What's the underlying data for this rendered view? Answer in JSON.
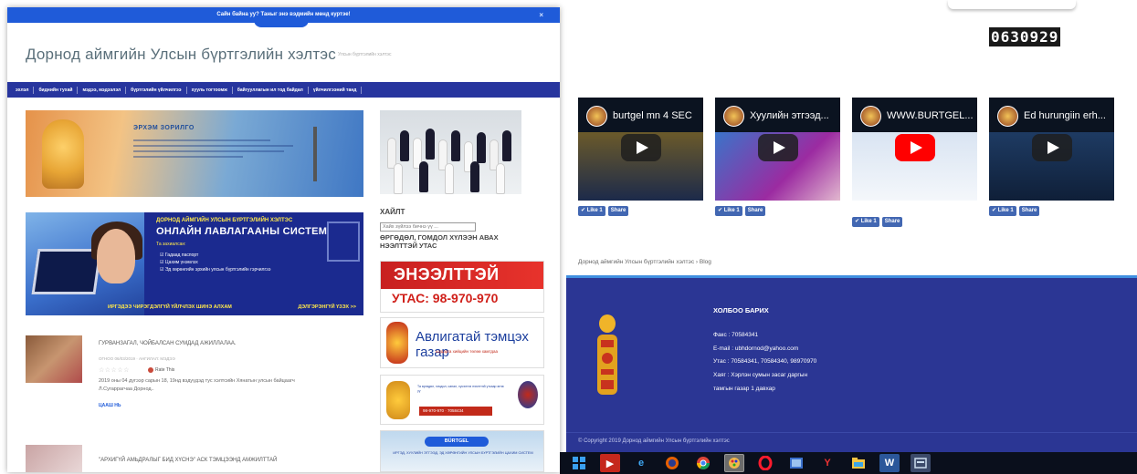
{
  "left_window": {
    "notice": "Сайн байна уу? Таныг энэ вэдмийн мөнд куртэе!",
    "notice_close": "×",
    "site_title": "Дорнод аймгийн Улсын бүртгэлийн хэлтэс",
    "site_tagline": "Улсын бүртгэлийн хэлтэс",
    "nav_items": [
      "эхлэл",
      "биднийн тухай",
      "мэдээ, мэдээлэл",
      "бүртгэлийн үйлчилгээ",
      "хууль тогтоомж",
      "байгууллагын ил тод байдал",
      "үйлчилгээний танд"
    ],
    "banner1": {
      "title": "ЭРХЭМ ЗОРИЛГО"
    },
    "banner2": {
      "subtitle": "ДОРНОД АЙМГИЙН УЛСЫН БҮРТГЭЛИЙН ХЭЛТЭС",
      "title": "ОНЛАЙН ЛАВЛАГААНЫ СИСТЕМ",
      "lead": "Та захиалсан:",
      "items": [
        "Гадаад паспорт",
        "Цахим үнэмлэх",
        "Эд хөрөнгийн эрхийн улсын бүртгэлийн гэрчилгээ"
      ],
      "footer_left": "ИРГЭДЭЭ ЧИРЭГДЭЛГҮЙ ҮЙЛЧЛЭХ ШИНЭ АЛХАМ",
      "footer_right": "ДЭЛГЭРЭНГҮЙ ҮЗЭХ >>"
    },
    "posts": [
      {
        "title": "ГУРВАНЗАГАЛ, ЧОЙБАЛСАН СУМДАД АЖИЛЛАЛАА.",
        "meta": "ОГНОО 06/03/2019 · АНГИЛАЛ: МЭДЭЭ",
        "stars": "☆☆☆☆☆",
        "rate": "Rate This",
        "excerpt": "2019 оны 04 дүгээр сарын 18, 19нд вэдүүдэд тус хэлтсийн Хянатын улсын байцаагч Л.Сугаррагчаа Дорнод..",
        "more": "ЦААШ НЬ"
      },
      {
        "title": "\"АРХИГҮЙ АМЬДРАЛЫГ БИД ХҮСНЭ\" АСК ТЭМЦЭЭНД АМЖИЛТТАЙ",
        "meta": "",
        "stars": "",
        "rate": "",
        "excerpt": "",
        "more": ""
      }
    ],
    "sidebar": {
      "search_heading": "ХАЙЛТ",
      "search_placeholder": "Хайх зүйлээ бичнэ үү ...",
      "complaint_heading": "ӨРГӨДӨЛ, ГОМДОЛ ХҮЛЭЭН АВАХ НЭЭЛТТЭЙ УТАС",
      "ad1_title": "ЭНЭЭЛТТЭЙ",
      "ad1_phone": "УТАС: 98-970-970",
      "ad2_title": "Авлигатай тэмцэх газар",
      "ad2_sub": "шударга хийцийн төлөө хамтдаа",
      "ad3_text": "Та өргөдөл, гомдол, санал, хүсэлтээ нээлттэй утсаар өгнө үү",
      "ad3_phone": "98-970-970 · 7058434",
      "ad4_logo": "BÜRTGEL",
      "ad4_text": "ИРГЭД, ХУУЛИЙН ЭТГЭЭД, ЭД ХӨРӨНГИЙН УЛСЫН БҮРТГЭЛИЙН ЦАХИМ СИСТЕМ"
    }
  },
  "right_page": {
    "visitor_counter": "0630929",
    "videos": [
      {
        "title": "burtgel mn 4 SEC",
        "like": "✔ Like 1",
        "share": "Share",
        "play_style": "dark"
      },
      {
        "title": "Хуулийн этгээд...",
        "like": "✔ Like 1",
        "share": "Share",
        "play_style": "dark"
      },
      {
        "title": "WWW.BURTGEL...",
        "like": "✔ Like 1",
        "share": "Share",
        "play_style": "red"
      },
      {
        "title": "Ed hurungiin erh...",
        "like": "✔ Like 1",
        "share": "Share",
        "play_style": "dark"
      }
    ],
    "breadcrumb": "Дорнод аймгийн Улсын бүртгэлийн хэлтэс  ›  Blog",
    "footer": {
      "heading": "ХОЛБОО БАРИХ",
      "fax": "Факс : 70584341",
      "email": "E-mail : ubhdornod@yahoo.com",
      "phone": "Утас : 70584341, 70584340, 98970970",
      "address_1": "Хаяг : Хэрлэн сумын засаг даргын",
      "address_2": "тамгын газар 1 давхар",
      "copyright": "© Copyright 2019 Дорнод аймгийн Улсын бүртгэлийн хэлтэс"
    }
  },
  "taskbar": {
    "icons": [
      "start-icon",
      "media-icon",
      "ie-icon",
      "firefox-icon",
      "chrome-icon",
      "paint-icon",
      "opera-icon",
      "photos-icon",
      "yandex-icon",
      "folder-icon",
      "word-icon",
      "explorer-icon"
    ]
  },
  "colors": {
    "nav_blue": "#27359e",
    "notice_blue": "#1f5bd9",
    "footer_blue": "#2b3694",
    "fb_blue": "#4267b2",
    "youtube_red": "#ff0000"
  }
}
